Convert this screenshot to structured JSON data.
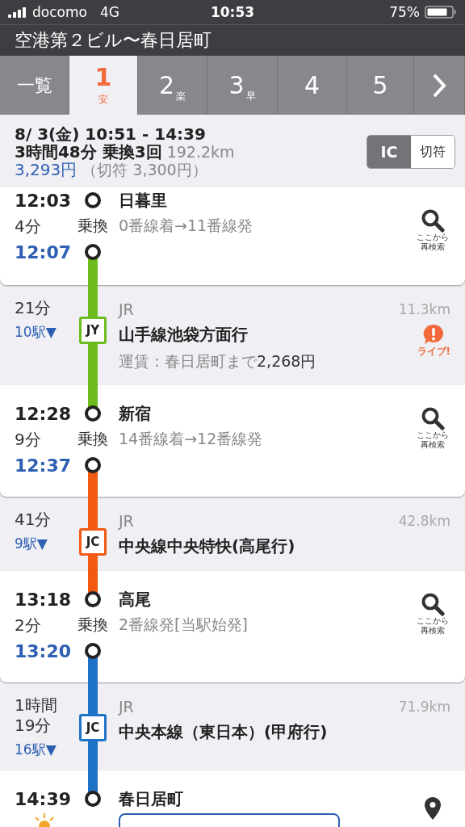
{
  "status_bar": {
    "carrier": "docomo",
    "network": "4G",
    "time": "10:53",
    "battery": "75%"
  },
  "title": "空港第２ビル〜春日居町",
  "tabs": [
    {
      "label": "一覧",
      "kind": "text",
      "selected": false
    },
    {
      "label": "1",
      "sub": "安",
      "kind": "number",
      "selected": true
    },
    {
      "label": "2",
      "sub": "楽",
      "kind": "number",
      "selected": false
    },
    {
      "label": "3",
      "sub": "早",
      "kind": "number",
      "selected": false
    },
    {
      "label": "4",
      "kind": "number",
      "selected": false
    },
    {
      "label": "5",
      "kind": "number",
      "selected": false
    },
    {
      "kind": "next",
      "selected": false
    }
  ],
  "summary": {
    "date_time": "8/ 3(金) 10:51 - 14:39",
    "duration_transfers": "3時間48分 乗換3回",
    "distance": "192.2km",
    "fare": "3,293円",
    "ticket_fare": "（切符 3,300円）",
    "fare_modes": [
      {
        "label": "IC",
        "selected": true
      },
      {
        "label": "切符",
        "selected": false
      }
    ]
  },
  "route": [
    {
      "kind": "station",
      "arrive": "12:03",
      "name": "日暮里",
      "dwell": "4分",
      "transfer": "乗換",
      "platform": "0番線着→11番線発",
      "depart": "12:07",
      "research": [
        "ここから",
        "再検索"
      ]
    },
    {
      "kind": "ride",
      "duration": [
        "21分"
      ],
      "stops": "10駅",
      "stops_caret": "▼",
      "operator": "JR",
      "line_code": "JY",
      "line_name": "山手線池袋方面行",
      "fare_label": "運賃：春日居町まで",
      "fare_amount": "2,268円",
      "distance": "11.3km",
      "live": "ライブ!",
      "color": "#6dbd1e"
    },
    {
      "kind": "station",
      "arrive": "12:28",
      "name": "新宿",
      "dwell": "9分",
      "transfer": "乗換",
      "platform": "14番線着→12番線発",
      "depart": "12:37",
      "research": [
        "ここから",
        "再検索"
      ]
    },
    {
      "kind": "ride",
      "duration": [
        "41分"
      ],
      "stops": "9駅",
      "stops_caret": "▼",
      "operator": "JR",
      "line_code": "JC",
      "line_name": "中央線中央特快(高尾行)",
      "distance": "42.8km",
      "color": "#f25a12"
    },
    {
      "kind": "station",
      "arrive": "13:18",
      "name": "高尾",
      "dwell": "2分",
      "transfer": "乗換",
      "platform": "2番線発[当駅始発]",
      "depart": "13:20",
      "research": [
        "ここから",
        "再検索"
      ]
    },
    {
      "kind": "ride",
      "duration": [
        "1時間",
        "19分"
      ],
      "stops": "16駅",
      "stops_caret": "▼",
      "operator": "JR",
      "line_code": "JC",
      "line_name": "中央本線（東日本）(甲府行)",
      "distance": "71.9km",
      "color": "#1f73c7"
    },
    {
      "kind": "station",
      "arrive": "14:39",
      "name": "春日居町"
    }
  ]
}
